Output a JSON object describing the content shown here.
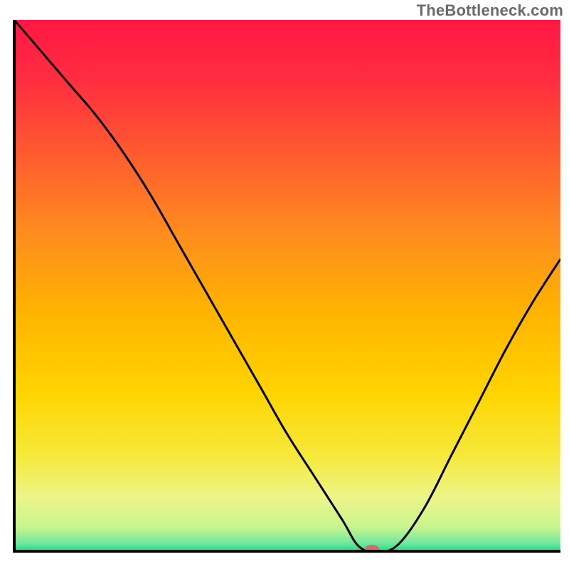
{
  "watermark": "TheBottleneck.com",
  "chart_data": {
    "type": "line",
    "title": "",
    "xlabel": "",
    "ylabel": "",
    "xlim": [
      0,
      100
    ],
    "ylim": [
      0,
      100
    ],
    "grid": false,
    "legend": false,
    "background_gradient_stops": [
      {
        "offset": 0.0,
        "color": "#ff1744"
      },
      {
        "offset": 0.12,
        "color": "#ff2f3f"
      },
      {
        "offset": 0.25,
        "color": "#ff5a2f"
      },
      {
        "offset": 0.4,
        "color": "#ff8c1f"
      },
      {
        "offset": 0.55,
        "color": "#ffb400"
      },
      {
        "offset": 0.7,
        "color": "#ffd400"
      },
      {
        "offset": 0.82,
        "color": "#f6e93a"
      },
      {
        "offset": 0.9,
        "color": "#ecf58a"
      },
      {
        "offset": 0.955,
        "color": "#c7f58e"
      },
      {
        "offset": 0.985,
        "color": "#6fe8a0"
      },
      {
        "offset": 1.0,
        "color": "#18df89"
      }
    ],
    "series": [
      {
        "name": "bottleneck-curve",
        "x": [
          0,
          5,
          10,
          15,
          20,
          25,
          30,
          35,
          40,
          45,
          50,
          55,
          60,
          63,
          66,
          70,
          75,
          80,
          85,
          90,
          95,
          100
        ],
        "y": [
          100,
          94,
          88,
          82,
          75,
          67,
          58,
          49,
          40,
          31,
          22,
          14,
          6,
          1,
          0,
          1,
          8,
          18,
          28,
          38,
          47,
          55
        ]
      }
    ],
    "marker": {
      "x": 65.5,
      "y": 0,
      "color": "#d46a6a",
      "rx": 10,
      "ry": 6
    },
    "axis_color": "#000000",
    "curve_color": "#000000",
    "curve_width": 3
  }
}
